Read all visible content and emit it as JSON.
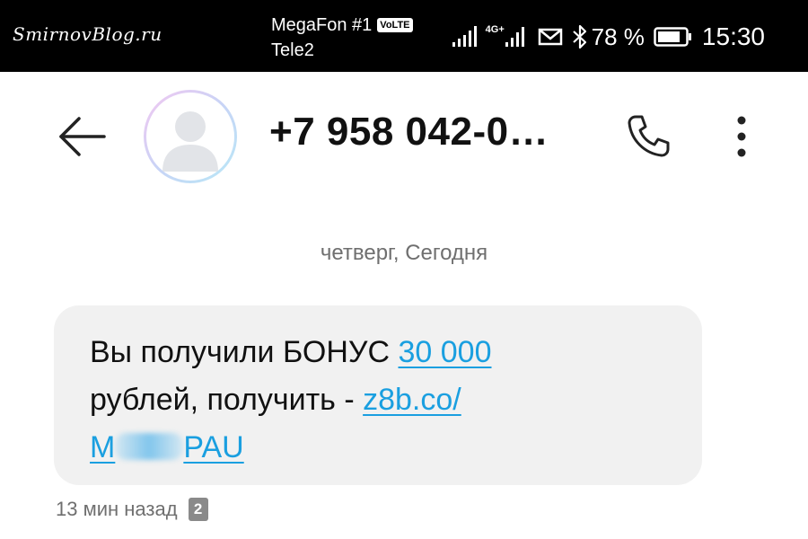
{
  "status_bar": {
    "watermark": "SmirnovBlog.ru",
    "carrier_primary": "MegaFon #1",
    "volte_badge": "VoLTE",
    "carrier_secondary": "Tele2",
    "network_badge": "4G+",
    "battery_level": "78 %",
    "time": "15:30",
    "icons": [
      "signal-icon",
      "signal-4g-icon",
      "message-icon",
      "bluetooth-icon",
      "battery-icon"
    ]
  },
  "header": {
    "contact_name": "+7 958 042-0…",
    "back_icon": "arrow-left-icon",
    "call_icon": "phone-icon",
    "menu_icon": "more-vertical-icon"
  },
  "conversation": {
    "date_separator": "четверг, Сегодня",
    "message": {
      "text_1": "Вы получили БОНУС ",
      "link_amount": "30 000",
      "text_2": " рублей, получить - ",
      "link_url_start": "z8b.co/",
      "link_url_prefix": "M",
      "link_url_suffix": "PAU",
      "timestamp": "13 мин назад",
      "sim_slot": "2"
    }
  },
  "colors": {
    "status_bar_bg": "#000000",
    "link": "#1a9fe0",
    "bubble_bg": "#f1f1f1",
    "meta_text": "#6f6f6f"
  }
}
